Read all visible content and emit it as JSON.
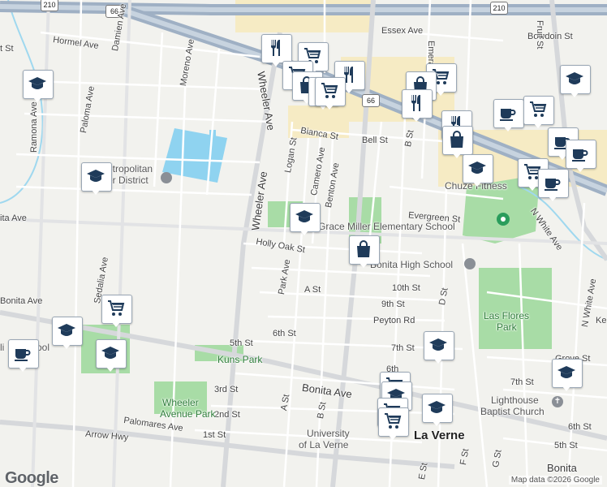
{
  "highways": {
    "i210_a": "210",
    "i210_b": "210",
    "hwy66_a": "66",
    "hwy66_b": "66"
  },
  "streets": {
    "hormel": "Hormel Ave",
    "damien": "Damien Ave",
    "moreno": "Moreno Ave",
    "wheeler": "Wheeler Ave",
    "logan": "Logan St",
    "bianca": "Bianca St",
    "bell": "Bell St",
    "camero": "Camero Ave",
    "benton": "Benton Ave",
    "evergreen": "Evergreen St",
    "holly_oak": "Holly Oak St",
    "park_ave": "Park Ave",
    "a_st": "A St",
    "tenth": "10th St",
    "ninth": "9th St",
    "peyton": "Peyton Rd",
    "sixth": "6th St",
    "fifth": "5th St",
    "seventh": "7th St",
    "bonita_w": "Bonita Ave",
    "bonita_mid": "Bonita Ave",
    "bonita_e": "Bonita Ave",
    "third": "3rd St",
    "second": "2nd St",
    "first": "1st St",
    "palomares": "Palomares Ave",
    "arrow": "Arrow Hwy",
    "a_st_s": "A St",
    "b_st_s": "B St",
    "b_st_n": "B St",
    "d_st": "D St",
    "e_st": "E St",
    "f_st": "F St",
    "g_st": "G St",
    "essex": "Essex Ave",
    "emerald": "Emerald Ave",
    "fruit": "Fruit St",
    "bowdoin": "Bowdoin St",
    "white_n": "N White Ave",
    "white_s": "N White Ave",
    "grove": "Grove St",
    "ke": "Ke",
    "seventh_e": "7th St",
    "sixth_e": "6th St",
    "fifth_e": "5th St",
    "paloma": "Paloma Ave",
    "ramona": "Ramona Ave",
    "sedalia": "Sedalia Ave",
    "ita": "ita Ave",
    "st_frag": "t St",
    "sixth_mid": "6th",
    "bonita_frag": "Bonita Ave",
    "bonita_se": "Bonita"
  },
  "places": {
    "metro_1": "etropolitan",
    "metro_2": "er District",
    "grace": "Grace Miller Elementary School",
    "bonita_hs": "Bonita High School",
    "chuze": "Chuze Fitness",
    "las_flores_1": "Las Flores",
    "las_flores_2": "Park",
    "kuns": "Kuns Park",
    "wheeler_park_1": "Wheeler",
    "wheeler_park_2": "Avenue Park",
    "lighthouse_1": "Lighthouse",
    "lighthouse_2": "Baptist Church",
    "ulv_1": "University",
    "ulv_2": "of La Verne",
    "la_verne": "La Verne",
    "li": "li",
    "ool": "ool"
  },
  "pins": [
    {
      "icon": "restaurant"
    },
    {
      "icon": "shopping-cart"
    },
    {
      "icon": "shopping-cart"
    },
    {
      "icon": "shopping-bag"
    },
    {
      "icon": "restaurant"
    },
    {
      "icon": "shopping-cart"
    },
    {
      "icon": "shopping-bag"
    },
    {
      "icon": "restaurant"
    },
    {
      "icon": "school"
    },
    {
      "icon": "restaurant"
    },
    {
      "icon": "shopping-bag"
    },
    {
      "icon": "coffee"
    },
    {
      "icon": "shopping-cart"
    },
    {
      "icon": "coffee"
    },
    {
      "icon": "coffee"
    },
    {
      "icon": "shopping-cart"
    },
    {
      "icon": "coffee"
    },
    {
      "icon": "school"
    },
    {
      "icon": "school"
    },
    {
      "icon": "school"
    },
    {
      "icon": "school"
    },
    {
      "icon": "shopping-bag"
    },
    {
      "icon": "shopping-cart"
    },
    {
      "icon": "school"
    },
    {
      "icon": "coffee"
    },
    {
      "icon": "school"
    },
    {
      "icon": "school"
    },
    {
      "icon": "school"
    },
    {
      "icon": "shopping-cart"
    },
    {
      "icon": "school"
    },
    {
      "icon": "school"
    },
    {
      "icon": "shopping-cart"
    },
    {
      "icon": "shopping-cart"
    },
    {
      "icon": "shopping-cart"
    },
    {
      "icon": "shopping-cart"
    }
  ],
  "attribution": {
    "logo": "Google",
    "map_data": "Map data ©2026 Google"
  },
  "colors": {
    "park": "#a8dca6",
    "water": "#8fd3f0",
    "commercial": "#f6ebc4",
    "freeway": "#9fb0c4",
    "pin_icon": "#1f3b5a",
    "background": "#f2f2ee"
  }
}
